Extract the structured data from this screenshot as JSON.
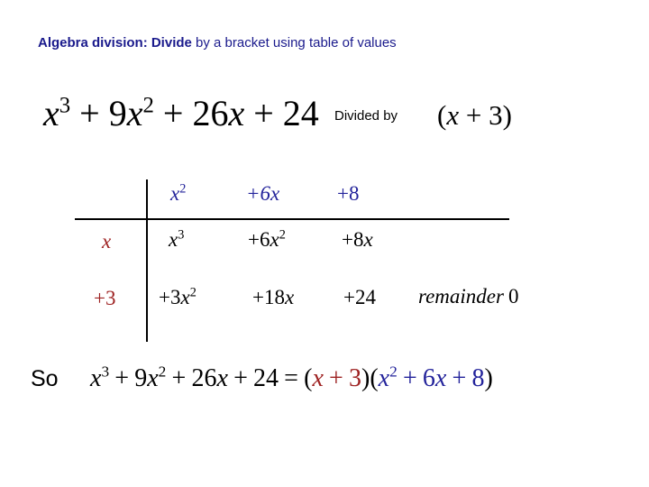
{
  "title": {
    "bold_part": "Algebra division: Divide",
    "rest_part": " by a bracket using table of values",
    "color": "#1a1a8c"
  },
  "problem": {
    "dividend": {
      "term1_base": "x",
      "term1_exp": "3",
      "op1": " + ",
      "term2_coef": "9",
      "term2_base": "x",
      "term2_exp": "2",
      "op2": " + ",
      "term3_coef": "26",
      "term3_base": "x",
      "op3": " + ",
      "term4": "24",
      "full_text": "x^3 + 9x^2 + 26x + 24"
    },
    "divided_by_label": "Divided by",
    "divisor": {
      "open_paren": "(",
      "variable": "x",
      "op": " + ",
      "constant": "3",
      "close_paren": ")",
      "full_text": "(x + 3)"
    }
  },
  "table": {
    "column_headers": [
      {
        "base": "x",
        "exp": "2",
        "text": "x^2"
      },
      {
        "base": "+6x",
        "exp": "",
        "text": "+6x"
      },
      {
        "base": "+8",
        "exp": "",
        "text": "+8"
      }
    ],
    "header_color": "#23239b",
    "row_label_color": "#9e2222",
    "rows": [
      {
        "label": "x",
        "cells": [
          {
            "coef": "",
            "base": "x",
            "exp": "3",
            "text": "x^3"
          },
          {
            "coef": "+6",
            "base": "x",
            "exp": "2",
            "text": "+6x^2"
          },
          {
            "coef": "+8",
            "base": "x",
            "exp": "",
            "text": "+8x"
          }
        ]
      },
      {
        "label": "+3",
        "cells": [
          {
            "coef": "+3",
            "base": "x",
            "exp": "2",
            "text": "+3x^2"
          },
          {
            "coef": "+18",
            "base": "x",
            "exp": "",
            "text": "+18x"
          },
          {
            "coef": "+24",
            "base": "",
            "exp": "",
            "text": "+24"
          }
        ]
      }
    ],
    "remainder_label": "remainder",
    "remainder_value": "0"
  },
  "conclusion": {
    "so_label": "So",
    "lhs": {
      "t1_base": "x",
      "t1_exp": "3",
      "op1": "+",
      "t2_coef": "9",
      "t2_base": "x",
      "t2_exp": "2",
      "op2": "+",
      "t3_coef": "26",
      "t3_base": "x",
      "op3": "+",
      "t4": "24",
      "text": "x^3 + 9x^2 + 26x + 24"
    },
    "equals": "=",
    "factor1": {
      "open": "(",
      "variable": "x",
      "op": "+",
      "constant": "3",
      "close": ")",
      "text": "(x + 3)",
      "color": "#9e2222"
    },
    "factor2": {
      "open": "(",
      "t1_base": "x",
      "t1_exp": "2",
      "op1": "+",
      "t2_coef": "6",
      "t2_base": "x",
      "op2": "+",
      "t3": "8",
      "close": ")",
      "text": "(x^2 + 6x + 8)",
      "color": "#23239b"
    }
  }
}
